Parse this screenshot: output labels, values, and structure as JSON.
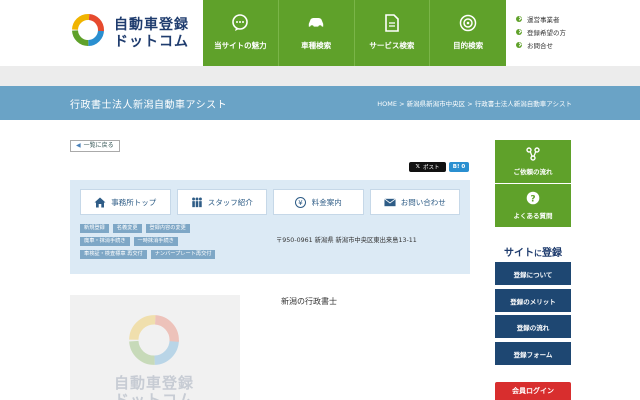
{
  "logo": {
    "line1": "自動車登録",
    "line2": "ドットコム"
  },
  "gnav": [
    {
      "label": "当サイトの魅力",
      "icon": "speech-bubble-icon"
    },
    {
      "label": "車種検索",
      "icon": "car-icon"
    },
    {
      "label": "サービス検索",
      "icon": "document-icon"
    },
    {
      "label": "目的検索",
      "icon": "target-icon"
    }
  ],
  "util": [
    {
      "label": "運営事業者"
    },
    {
      "label": "登録希望の方"
    },
    {
      "label": "お問合せ"
    }
  ],
  "title_bar": {
    "title": "行政書士法人新潟自動車アシスト",
    "breadcrumb": [
      "HOME",
      "新潟県新潟市中央区",
      "行政書士法人新潟自動車アシスト"
    ],
    "separator": ">"
  },
  "back_link": "一覧に戻る",
  "share": {
    "x_label": "ポスト",
    "hatena_label": "B! 0"
  },
  "office_tabs": [
    {
      "label": "事務所トップ",
      "icon": "house-icon"
    },
    {
      "label": "スタッフ紹介",
      "icon": "people-icon"
    },
    {
      "label": "料金案内",
      "icon": "yen-icon"
    },
    {
      "label": "お問い合わせ",
      "icon": "mail-icon"
    }
  ],
  "tags": [
    [
      "新規登録",
      "名義変更",
      "登録内容の変更"
    ],
    [
      "廃車・抹消手続き",
      "一時抹消手続き"
    ],
    [
      "車検証・検査標章 再交付",
      "ナンバープレート再交付"
    ]
  ],
  "office_address": "〒950-0961 新潟県 新潟市中央区東出来島13-11",
  "office_heading": "新潟の行政書士",
  "photo_placeholder": {
    "line1": "自動車登録",
    "line2": "ドットコム"
  },
  "sidebar": {
    "buttons": [
      {
        "label": "ご依頼の流れ",
        "icon": "flow-icon"
      },
      {
        "label": "よくある質問",
        "icon": "question-icon"
      }
    ],
    "heading_pre": "サイト",
    "heading_mid": "に",
    "heading_post": "登録",
    "nav": [
      "登録について",
      "登録のメリット",
      "登録の流れ",
      "登録フォーム"
    ],
    "login": "会員ログイン"
  },
  "colors": {
    "green": "#5fa12a",
    "title_blue": "#6aa3c6",
    "navy": "#1e4772",
    "tag_blue": "#7ea7c6",
    "login_red": "#d82e2e"
  }
}
